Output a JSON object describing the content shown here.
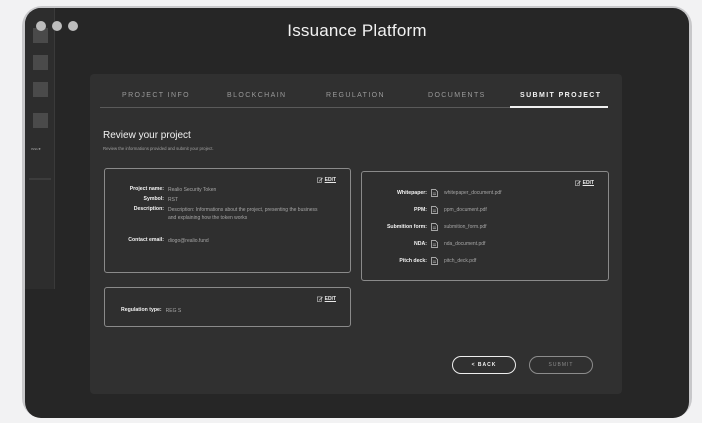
{
  "window": {
    "title": "Issuance Platform"
  },
  "sidebar": {
    "active_label": "ISSUE"
  },
  "tabs": [
    {
      "label": "PROJECT INFO"
    },
    {
      "label": "BLOCKCHAIN"
    },
    {
      "label": "REGULATION"
    },
    {
      "label": "DOCUMENTS"
    },
    {
      "label": "SUBMIT PROJECT",
      "active": true
    }
  ],
  "review": {
    "title": "Review your project",
    "subtitle": "Review the informations provided and submit your project."
  },
  "project_card": {
    "edit_label": "EDIT",
    "fields": [
      {
        "key": "Project name:",
        "value": "Realio Security Token"
      },
      {
        "key": "Symbol:",
        "value": "RST"
      },
      {
        "key": "Description:",
        "value": "Description: Informations about the project, presenting the business and explaining how the token works"
      },
      {
        "key": "Contact email:",
        "value": "diogo@realio.fund"
      }
    ]
  },
  "regulation_card": {
    "edit_label": "EDIT",
    "key": "Regulation type:",
    "value": "REG S"
  },
  "documents_card": {
    "edit_label": "EDIT",
    "items": [
      {
        "key": "Whitepaper:",
        "file": "whitepaper_document.pdf",
        "icon": "file-icon"
      },
      {
        "key": "PPM:",
        "file": "ppm_document.pdf",
        "icon": "file-icon"
      },
      {
        "key": "Submition form:",
        "file": "submition_form.pdf",
        "icon": "file-icon"
      },
      {
        "key": "NDA:",
        "file": "nda_document.pdf",
        "icon": "file-icon"
      },
      {
        "key": "Pitch deck:",
        "file": "pitch_deck.pdf",
        "icon": "file-icon"
      }
    ]
  },
  "actions": {
    "back_label": "< BACK",
    "submit_label": "SUBMIT"
  }
}
